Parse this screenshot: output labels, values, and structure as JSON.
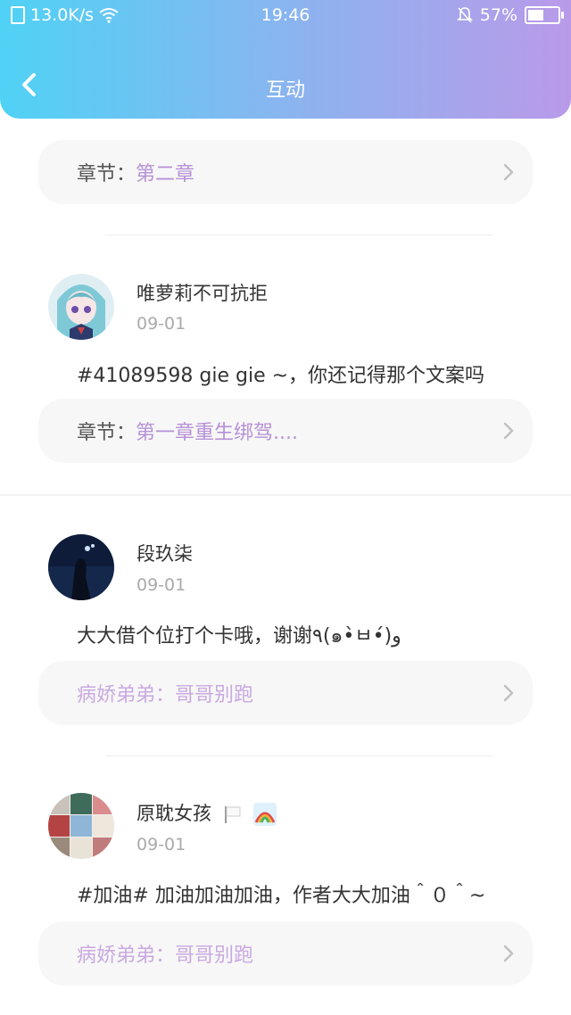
{
  "status_bar": {
    "speed": "13.0K/s",
    "time": "19:46",
    "battery": "57%",
    "battery_level": 0.57
  },
  "header": {
    "title": "互动"
  },
  "items": [
    {
      "chapter_label": "章节：",
      "chapter_value": "第二章"
    },
    {
      "username": "唯萝莉不可抗拒",
      "date": "09-01",
      "comment": "#41089598 gie gie ~，你还记得那个文案吗",
      "chapter_label": "章节：",
      "chapter_value": "第一章重生绑驾...."
    },
    {
      "username": "段玖柒",
      "date": "09-01",
      "comment": "大大借个位打个卡哦，谢谢٩(๑•̀ㅂ•́)و",
      "chapter_label": "病娇弟弟：",
      "chapter_value": "哥哥别跑"
    },
    {
      "username": "原耽女孩",
      "date": "09-01",
      "comment": "#加油# 加油加油加油，作者大大加油＾０＾~",
      "chapter_label": "病娇弟弟：",
      "chapter_value": "哥哥别跑"
    }
  ],
  "colors": {
    "header_gradient_start": "#4fd2f5",
    "header_gradient_end": "#b99ae9",
    "chapter_accent": "#b691d6"
  }
}
